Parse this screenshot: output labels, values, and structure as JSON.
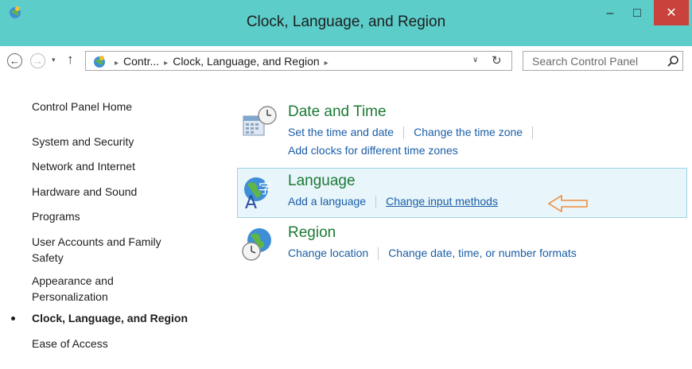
{
  "window": {
    "title": "Clock, Language, and Region",
    "minimize_symbol": "–",
    "maximize_symbol": "□",
    "close_symbol": "✕"
  },
  "address_bar": {
    "back_symbol": "←",
    "forward_symbol": "→",
    "recent_symbol": "▾",
    "up_symbol": "↑",
    "breadcrumbs": [
      "Contr...",
      "Clock, Language, and Region"
    ],
    "separator": "▸",
    "dropdown_symbol": "∨",
    "refresh_symbol": "↻",
    "search_placeholder": "Search Control Panel"
  },
  "sidebar": {
    "items": [
      {
        "label": "Control Panel Home"
      },
      {
        "label": "System and Security"
      },
      {
        "label": "Network and Internet"
      },
      {
        "label": "Hardware and Sound"
      },
      {
        "label": "Programs"
      },
      {
        "label": "User Accounts and Family",
        "label2": "Safety"
      },
      {
        "label": "Appearance and",
        "label2": "Personalization"
      },
      {
        "label": "Clock, Language, and Region",
        "active": true
      },
      {
        "label": "Ease of Access"
      }
    ]
  },
  "categories": [
    {
      "title": "Date and Time",
      "icon": "clock-calendar-icon",
      "links": [
        "Set the time and date",
        "Change the time zone",
        "Add clocks for different time zones"
      ]
    },
    {
      "title": "Language",
      "icon": "globe-language-icon",
      "links": [
        "Add a language",
        "Change input methods"
      ],
      "highlighted": true
    },
    {
      "title": "Region",
      "icon": "globe-clock-icon",
      "links": [
        "Change location",
        "Change date, time, or number formats"
      ]
    }
  ],
  "colors": {
    "titlebar": "#5ccdc9",
    "close_button": "#c9423b",
    "category_title": "#1c7a35",
    "link": "#1a5ea6",
    "highlight_bg": "#e8f5fb",
    "highlight_border": "#9fd2e8",
    "annotation_arrow": "#f28c38"
  }
}
